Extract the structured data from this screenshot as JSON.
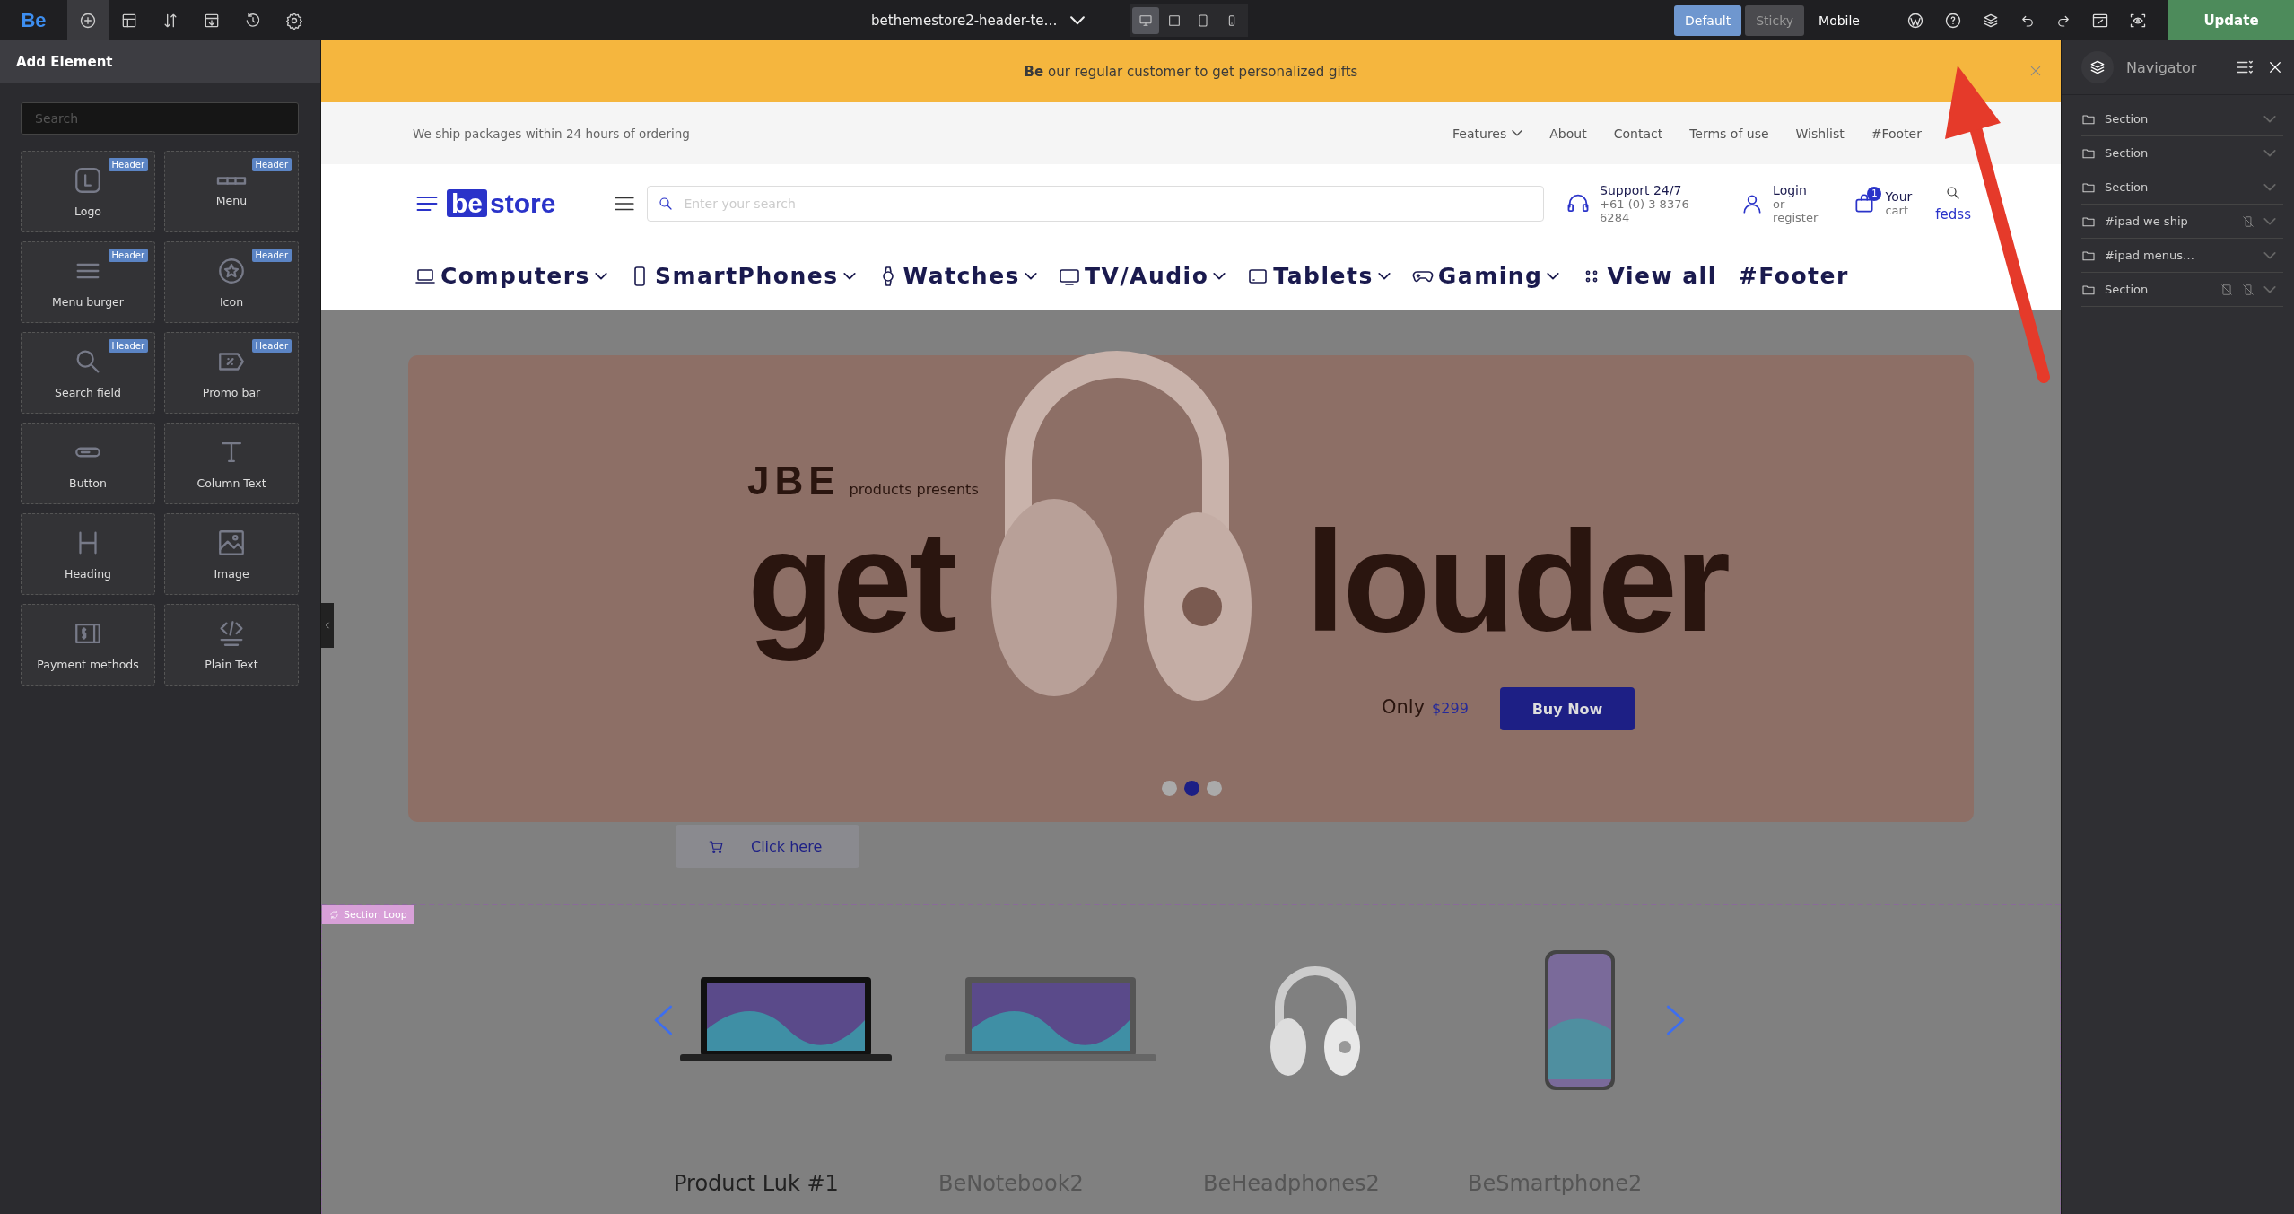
{
  "toolbar": {
    "logo": "Be",
    "tools": [
      {
        "kind": "add",
        "selected": true
      },
      {
        "kind": "layout",
        "selected": false
      },
      {
        "kind": "sort",
        "selected": false
      },
      {
        "kind": "export",
        "selected": false
      },
      {
        "kind": "history",
        "selected": false
      },
      {
        "kind": "settings",
        "selected": false
      }
    ],
    "page_title": "bethemestore2-header-te…",
    "devices": [
      {
        "kind": "desktop",
        "selected": true
      },
      {
        "kind": "tablet",
        "selected": false
      },
      {
        "kind": "tablet-portrait",
        "selected": false
      },
      {
        "kind": "mobile",
        "selected": false
      }
    ],
    "modes": [
      {
        "label": "Default",
        "selected": true
      },
      {
        "label": "Sticky",
        "selected": false
      },
      {
        "label": "Mobile",
        "selected": false
      }
    ],
    "update": "Update"
  },
  "add_element": {
    "title": "Add Element",
    "search": {
      "placeholder": "Search"
    },
    "elements": [
      {
        "kind": "logo",
        "label": "Logo",
        "badge": "Header"
      },
      {
        "kind": "menu",
        "label": "Menu",
        "badge": "Header"
      },
      {
        "kind": "burger",
        "label": "Menu burger",
        "badge": "Header"
      },
      {
        "kind": "icon",
        "label": "Icon",
        "badge": "Header"
      },
      {
        "kind": "search",
        "label": "Search field",
        "badge": "Header"
      },
      {
        "kind": "promo",
        "label": "Promo bar",
        "badge": "Header"
      },
      {
        "kind": "button",
        "label": "Button"
      },
      {
        "kind": "text",
        "label": "Column Text"
      },
      {
        "kind": "heading",
        "label": "Heading"
      },
      {
        "kind": "image",
        "label": "Image"
      },
      {
        "kind": "payment",
        "label": "Payment methods"
      },
      {
        "kind": "code",
        "label": "Plain Text"
      }
    ]
  },
  "canvas": {
    "promo_bar": {
      "text": "**Be** our regular customer to get personalized gifts"
    },
    "top_bar": {
      "shipping": "We ship packages within 24 hours of ordering",
      "links": [
        {
          "label": "Features",
          "dropdown": true
        },
        {
          "label": "About",
          "dropdown": false
        },
        {
          "label": "Contact",
          "dropdown": false
        },
        {
          "label": "Terms of use",
          "dropdown": false
        },
        {
          "label": "Wishlist",
          "dropdown": false
        },
        {
          "label": "#Footer",
          "dropdown": false
        }
      ]
    },
    "header": {
      "logo_be": "be",
      "logo_store": "store",
      "search": {
        "placeholder": "Enter your search"
      },
      "support": {
        "title": "Support 24/7",
        "phone": "+61 (0) 3 8376 6284"
      },
      "login": {
        "title": "Login",
        "subtitle": "or register"
      },
      "cart": {
        "count": "1",
        "title": "Your",
        "subtitle": "cart"
      },
      "search_label": "fedss"
    },
    "categories": [
      {
        "kind": "laptop",
        "label": "Computers",
        "dropdown": true
      },
      {
        "kind": "phone",
        "label": "SmartPhones",
        "dropdown": true
      },
      {
        "kind": "watch",
        "label": "Watches",
        "dropdown": true
      },
      {
        "kind": "tv",
        "label": "TV/Audio",
        "dropdown": true
      },
      {
        "kind": "tablet",
        "label": "Tablets",
        "dropdown": true
      },
      {
        "kind": "gamepad",
        "label": "Gaming",
        "dropdown": true
      },
      {
        "kind": "dots",
        "label": "View all",
        "dropdown": false
      },
      {
        "kind": "none",
        "label": "#Footer",
        "dropdown": false
      }
    ],
    "hero": {
      "brand": "JBE",
      "presents": "products presents",
      "word_left": "get",
      "word_right": "louder",
      "only": "Only",
      "price": "$299",
      "cta": "Buy Now",
      "dots": [
        {
          "selected": false
        },
        {
          "selected": true
        },
        {
          "selected": false
        }
      ]
    },
    "click_button": "Click here",
    "section_label": "Section Loop",
    "products": [
      {
        "kind": "laptop",
        "name": "Product Luk #1"
      },
      {
        "kind": "laptop",
        "name": "BeNotebook2"
      },
      {
        "kind": "headphones",
        "name": "BeHeadphones2"
      },
      {
        "kind": "phone",
        "name": "BeSmartphone2"
      }
    ]
  },
  "navigator": {
    "title": "Navigator",
    "items": [
      {
        "label": "Section",
        "hidden_tablet": false,
        "hidden_mobile": false
      },
      {
        "label": "Section",
        "hidden_tablet": false,
        "hidden_mobile": false
      },
      {
        "label": "Section",
        "hidden_tablet": false,
        "hidden_mobile": false
      },
      {
        "label": "#ipad we ship",
        "hidden_tablet": false,
        "hidden_mobile": true
      },
      {
        "label": "#ipad menus…",
        "hidden_tablet": false,
        "hidden_mobile": false
      },
      {
        "label": "Section",
        "hidden_tablet": true,
        "hidden_mobile": true
      }
    ]
  }
}
